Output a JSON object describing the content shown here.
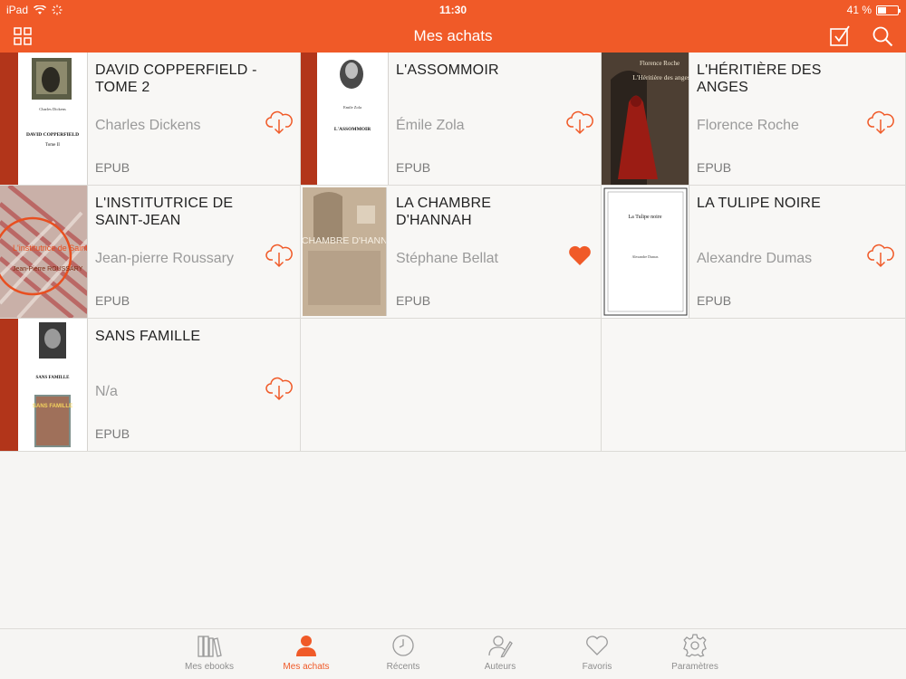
{
  "status_bar": {
    "device": "iPad",
    "time": "11:30",
    "battery": "41 %",
    "battery_level": 0.41
  },
  "navbar": {
    "title": "Mes achats",
    "grid_icon": "grid-view-icon",
    "select_icon": "checkbox-select-icon",
    "search_icon": "search-icon"
  },
  "books": [
    {
      "title": "DAVID COPPERFIELD - TOME 2",
      "author": "Charles Dickens",
      "format": "EPUB",
      "action": "cloud-download-icon",
      "cover": {
        "heading": "DAVID COPPERFIELD",
        "sub": "Tome II",
        "author": "Charles Dickens"
      }
    },
    {
      "title": "L'ASSOMMOIR",
      "author": "Émile Zola",
      "format": "EPUB",
      "action": "cloud-download-icon",
      "cover": {
        "heading": "L'ASSOMMOIR",
        "author": "Emile Zola"
      }
    },
    {
      "title": "L'HÉRITIÈRE DES ANGES",
      "author": "Florence Roche",
      "format": "EPUB",
      "action": "cloud-download-icon",
      "cover": {
        "author": "Florence Roche",
        "heading": "L'Héritière des anges"
      }
    },
    {
      "title": "L'INSTITUTRICE DE SAINT-JEAN",
      "author": "Jean-pierre Roussary",
      "format": "EPUB",
      "action": "cloud-download-icon",
      "cover": {
        "heading": "L'institutrice de Saint-Jean",
        "author": "Jean-Pierre ROUSSARY"
      }
    },
    {
      "title": "LA CHAMBRE D'HANNAH",
      "author": "Stéphane Bellat",
      "format": "EPUB",
      "action": "heart-icon",
      "cover": {
        "heading": "LA CHAMBRE D'HANNAH"
      }
    },
    {
      "title": "LA TULIPE NOIRE",
      "author": "Alexandre Dumas",
      "format": "EPUB",
      "action": "cloud-download-icon",
      "cover": {
        "heading": "La Tulipe noire",
        "author": "Alexandre Dumas"
      }
    },
    {
      "title": "SANS FAMILLE",
      "author": "N/a",
      "format": "EPUB",
      "action": "cloud-download-icon",
      "cover": {
        "heading": "SANS FAMILLE",
        "art_text": "SANS FAMILLE"
      }
    }
  ],
  "tabs": [
    {
      "label": "Mes ebooks",
      "icon": "bookshelf-icon",
      "active": false
    },
    {
      "label": "Mes achats",
      "icon": "person-icon",
      "active": true
    },
    {
      "label": "Récents",
      "icon": "clock-icon",
      "active": false
    },
    {
      "label": "Auteurs",
      "icon": "authors-icon",
      "active": false
    },
    {
      "label": "Favoris",
      "icon": "heart-outline-icon",
      "active": false
    },
    {
      "label": "Paramètres",
      "icon": "gear-icon",
      "active": false
    }
  ],
  "colors": {
    "accent": "#f05a28",
    "text": "#222222",
    "muted": "#9a9a9a"
  }
}
